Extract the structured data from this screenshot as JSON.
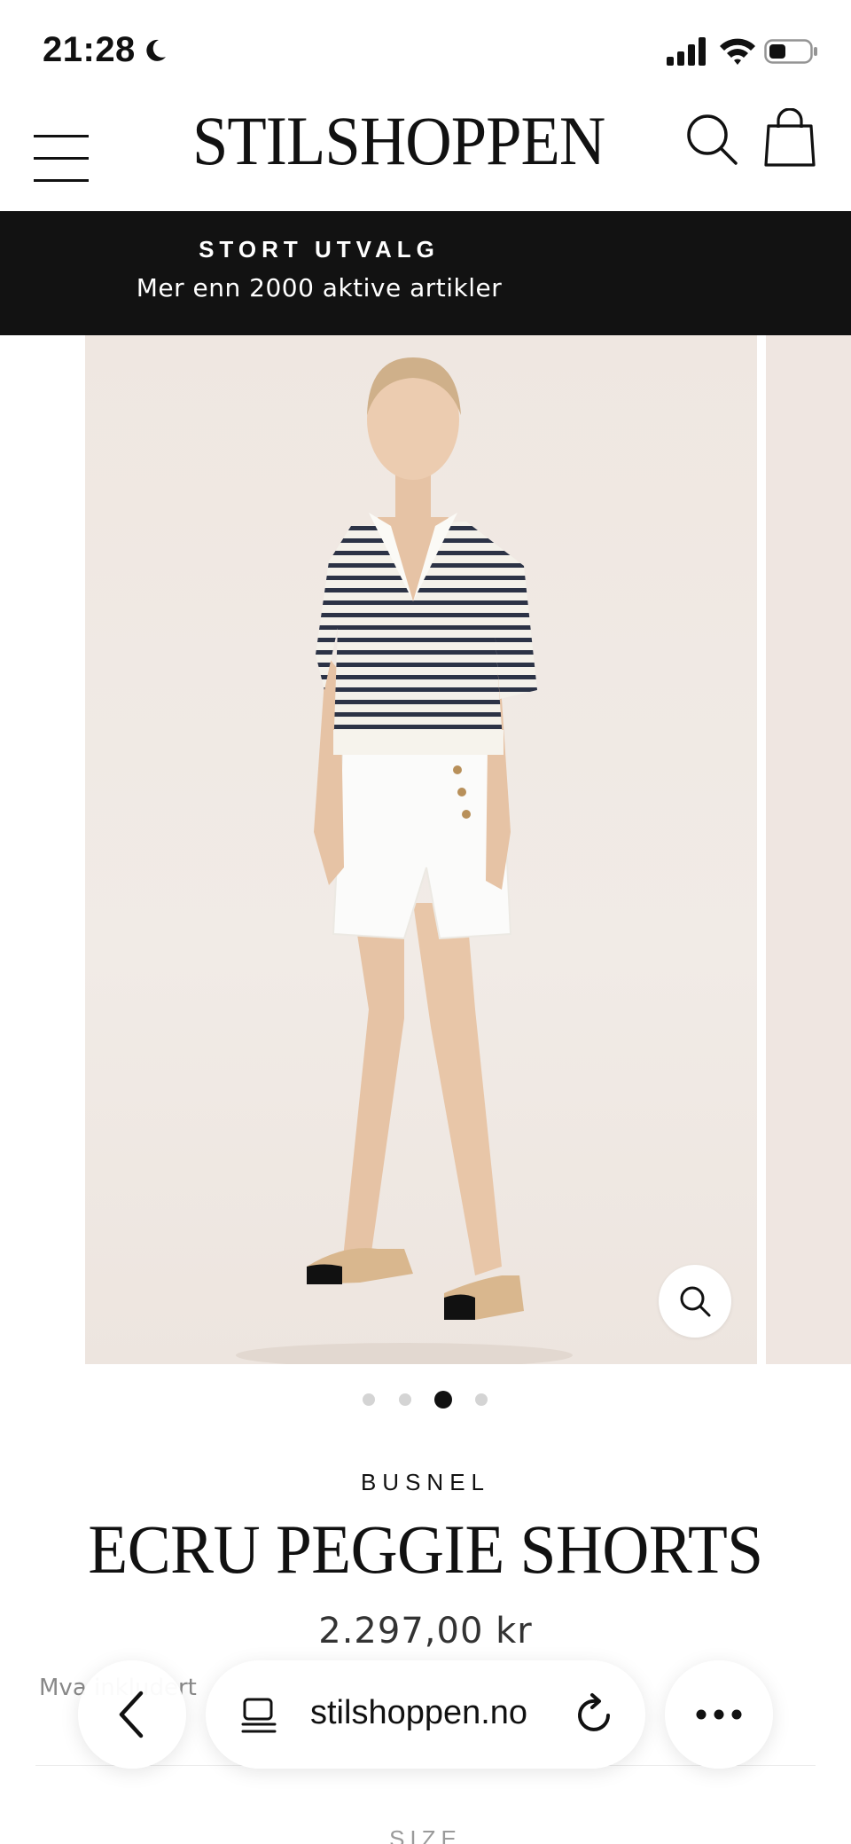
{
  "status_bar": {
    "time": "21:28",
    "moon_icon": "moon-icon",
    "signal_icon": "cellular-signal-icon",
    "wifi_icon": "wifi-icon",
    "battery_icon": "battery-icon",
    "battery_level": 0.35
  },
  "header": {
    "logo": "STILSHOPPEN",
    "menu_icon": "hamburger-menu-icon",
    "search_icon": "search-icon",
    "cart_icon": "shopping-bag-icon"
  },
  "banner": {
    "title": "STORT UTVALG",
    "subtitle": "Mer enn 2000 aktive artikler"
  },
  "carousel": {
    "image_description_icon": "product-photo",
    "zoom_icon": "zoom-icon",
    "slide_count": 4,
    "active_index": 2
  },
  "product": {
    "brand": "BUSNEL",
    "title": "ECRU PEGGIE SHORTS",
    "price": "2.297,00 kr",
    "vat_note": "Mva inkludert",
    "size_label": "SIZE"
  },
  "browser": {
    "back_icon": "back-chevron-icon",
    "url": "stilshoppen.no",
    "tabs_icon": "page-tabs-icon",
    "reload_icon": "reload-icon",
    "more_icon": "more-dots-icon"
  },
  "colors": {
    "banner_bg": "#121212",
    "text": "#111111",
    "dot_active": "#111111",
    "dot_inactive": "#d4d4d4"
  }
}
